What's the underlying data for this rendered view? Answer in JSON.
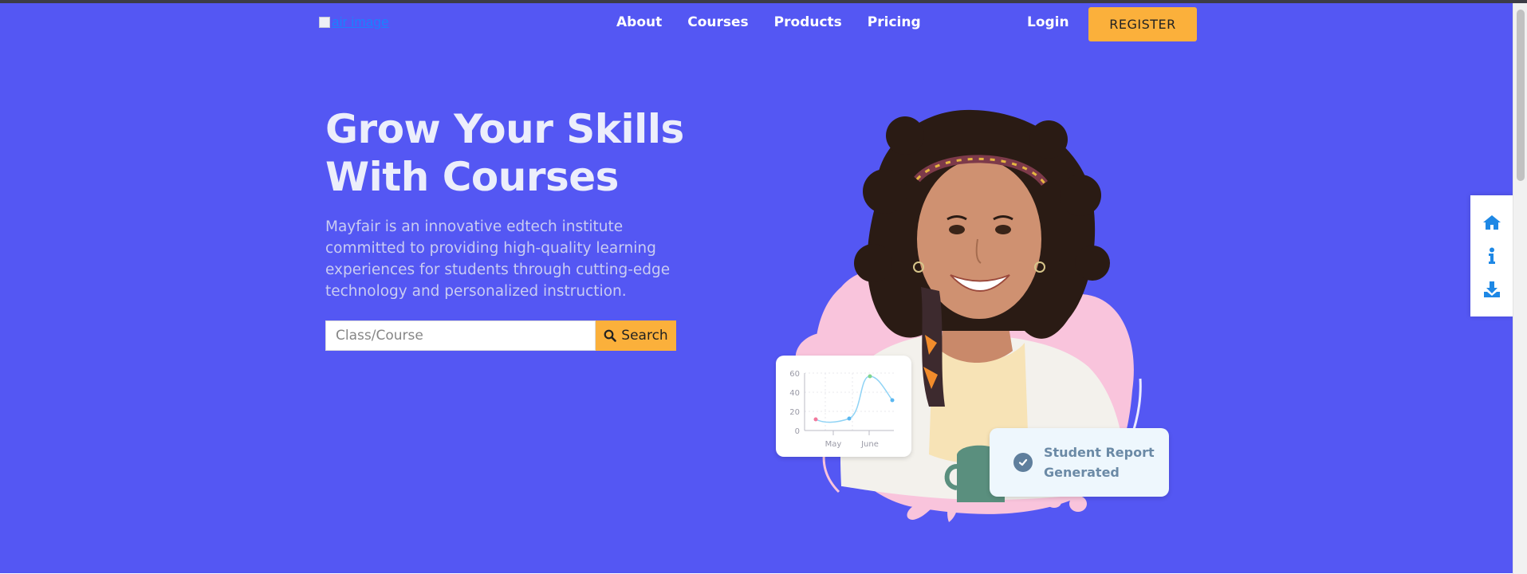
{
  "header": {
    "logo_alt": "air image",
    "nav_items": [
      {
        "label": "About"
      },
      {
        "label": "Courses"
      },
      {
        "label": "Products"
      },
      {
        "label": "Pricing"
      }
    ],
    "login_label": "Login",
    "register_label": "REGISTER"
  },
  "hero": {
    "headline_line1": "Grow Your Skills",
    "headline_line2": "With Courses",
    "description": "Mayfair is an innovative edtech institute committed to providing high-quality learning experiences for students through cutting-edge technology and personalized instruction.",
    "search": {
      "placeholder": "Class/Course",
      "button_label": "Search"
    }
  },
  "chart_card": {
    "y_ticks": [
      "60",
      "40",
      "20",
      "0"
    ],
    "x_ticks": [
      "May",
      "June"
    ]
  },
  "report_card": {
    "line1": "Student Report",
    "line2": "Generated"
  },
  "side_widget": {
    "icons": [
      "home-icon",
      "info-icon",
      "download-icon"
    ]
  },
  "colors": {
    "hero_background": "#5457f3",
    "accent": "#fbb03b",
    "side_icon": "#1e88e5"
  }
}
